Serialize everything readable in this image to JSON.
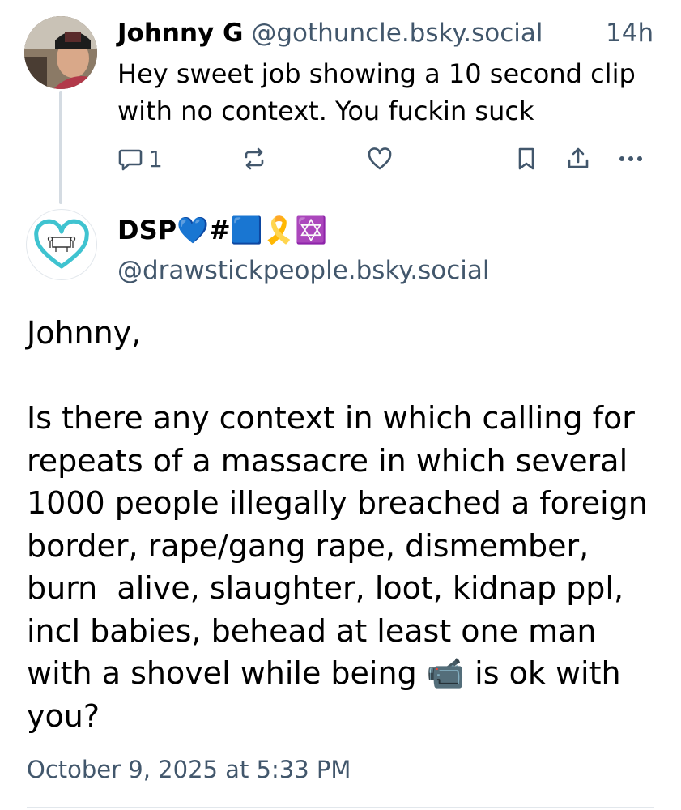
{
  "reply": {
    "display_name": "Johnny G",
    "handle": "@gothuncle.bsky.social",
    "time": "14h",
    "text": "Hey sweet job showing a 10 second clip with no context. You fuckin suck",
    "reply_count": "1",
    "avatar_icon": "profile-photo"
  },
  "post": {
    "display_name": "DSP💙#🟦🎗️✡️",
    "handle": "@drawstickpeople.bsky.social",
    "text": "Johnny,\n\nIs there any context in which calling for repeats of a massacre in which several 1000 people illegally breached a foreign border, rape/gang rape, dismember, burn  alive, slaughter, loot, kidnap ppl, incl babies, behead at least one man with a shovel while being 📹 is ok with you?",
    "date": "October 9, 2025 at 5:33 PM",
    "avatar_icon": "heart-drawing-logo"
  },
  "colors": {
    "meta_text": "#42576c",
    "thread_line": "#d4dbe2",
    "divider": "#e2e7ec",
    "avatar_heart": "#3fc3d0"
  }
}
